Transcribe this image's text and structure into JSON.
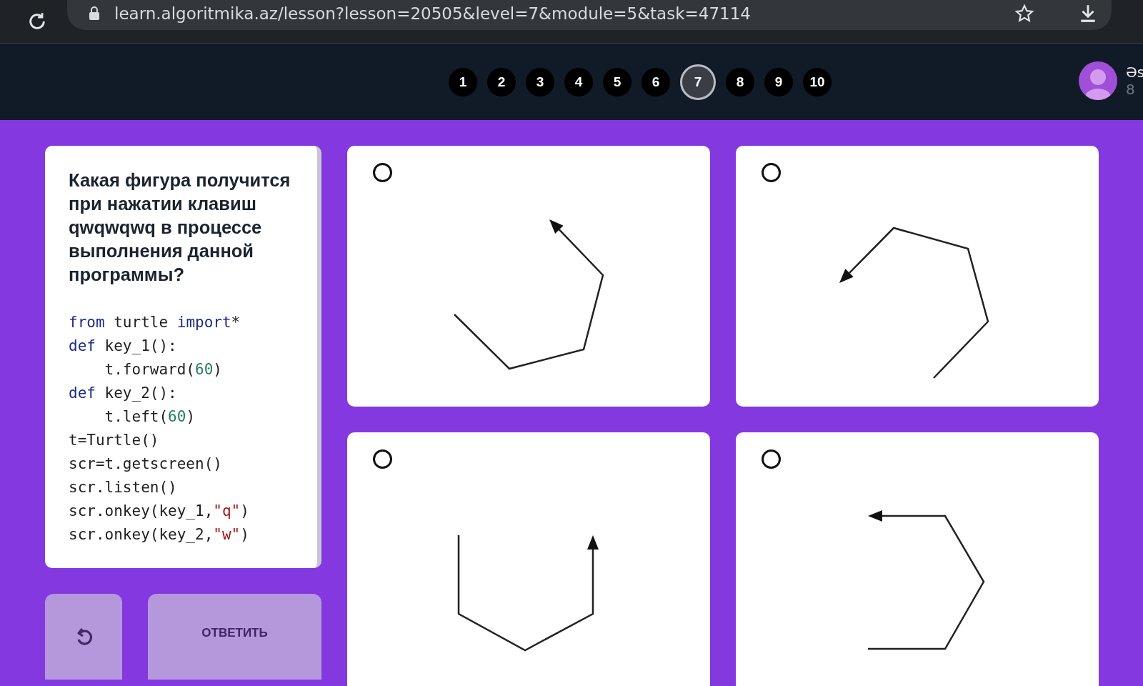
{
  "browser": {
    "url": "learn.algoritmika.az/lesson?lesson=20505&level=7&module=5&task=47114"
  },
  "steps": [
    {
      "label": "1",
      "selected": false
    },
    {
      "label": "2",
      "selected": false
    },
    {
      "label": "3",
      "selected": false
    },
    {
      "label": "4",
      "selected": false
    },
    {
      "label": "5",
      "selected": false
    },
    {
      "label": "6",
      "selected": false
    },
    {
      "label": "7",
      "selected": true
    },
    {
      "label": "8",
      "selected": false
    },
    {
      "label": "9",
      "selected": false
    },
    {
      "label": "10",
      "selected": false
    }
  ],
  "user": {
    "name": "Əs",
    "detail": "8"
  },
  "question": "Какая фигура получится при нажатии клавиш\nqwqwqwq в процессе выполнения данной программы?",
  "code": [
    [
      {
        "kind": "keyword",
        "text": "from"
      },
      {
        "kind": "plain",
        "text": " turtle "
      },
      {
        "kind": "keyword",
        "text": "import"
      },
      {
        "kind": "plain",
        "text": "*"
      }
    ],
    [
      {
        "kind": "keyword",
        "text": "def"
      },
      {
        "kind": "plain",
        "text": " key_1():"
      }
    ],
    [
      {
        "kind": "plain",
        "text": "    t.forward("
      },
      {
        "kind": "number",
        "text": "60"
      },
      {
        "kind": "plain",
        "text": ")"
      }
    ],
    [
      {
        "kind": "keyword",
        "text": "def"
      },
      {
        "kind": "plain",
        "text": " key_2():"
      }
    ],
    [
      {
        "kind": "plain",
        "text": "    t.left("
      },
      {
        "kind": "number",
        "text": "60"
      },
      {
        "kind": "plain",
        "text": ")"
      }
    ],
    [
      {
        "kind": "plain",
        "text": "t=Turtle()"
      }
    ],
    [
      {
        "kind": "plain",
        "text": "scr=t.getscreen()"
      }
    ],
    [
      {
        "kind": "plain",
        "text": "scr.listen()"
      }
    ],
    [
      {
        "kind": "plain",
        "text": "scr.onkey(key_1,"
      },
      {
        "kind": "string",
        "text": "\"q\""
      },
      {
        "kind": "plain",
        "text": ")"
      }
    ],
    [
      {
        "kind": "plain",
        "text": "scr.onkey(key_2,"
      },
      {
        "kind": "string",
        "text": "\"w\""
      },
      {
        "kind": "plain",
        "text": ")"
      }
    ]
  ],
  "options": [
    {
      "selected": false
    },
    {
      "selected": false
    },
    {
      "selected": false
    },
    {
      "selected": false
    }
  ],
  "answer_button": {
    "label": "ОТВЕТИТЬ",
    "disabled": true
  }
}
